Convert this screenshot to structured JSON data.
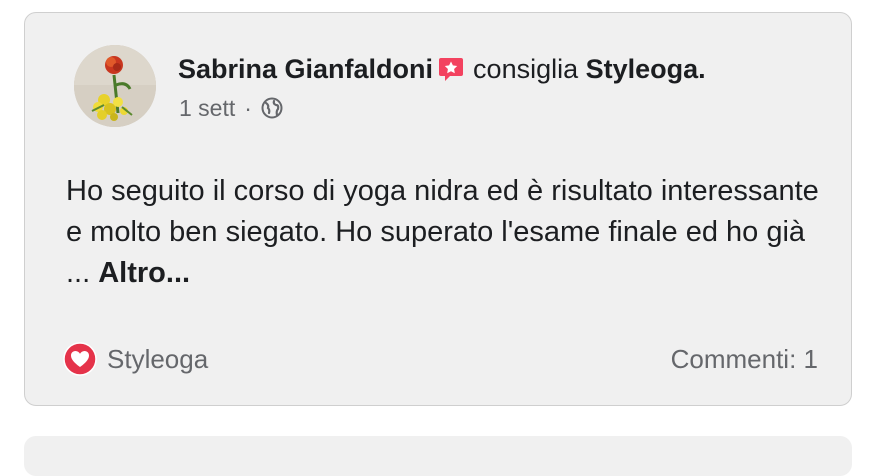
{
  "post": {
    "author": "Sabrina Gianfaldoni",
    "action_text": "consiglia",
    "page_name": "Styleoga.",
    "time": "1 sett",
    "separator": "·",
    "privacy_icon": "globe-icon",
    "recommend_icon": "recommendation-badge-icon",
    "body": "Ho seguito il corso di yoga nidra ed è risultato interessante e molto ben siegato. Ho superato l'esame finale ed ho già ...",
    "more_label": "Altro...",
    "reaction_icon": "love-reaction-icon",
    "reaction_label": "Styleoga",
    "comments_label": "Commenti: 1"
  },
  "colors": {
    "card_background": "#f0f0f0",
    "card_border": "#cfcfcf",
    "primary_text": "#1c1e21",
    "secondary_text": "#65676b",
    "recommend_badge": "#f3425f",
    "love_reaction": "#e5334a"
  }
}
